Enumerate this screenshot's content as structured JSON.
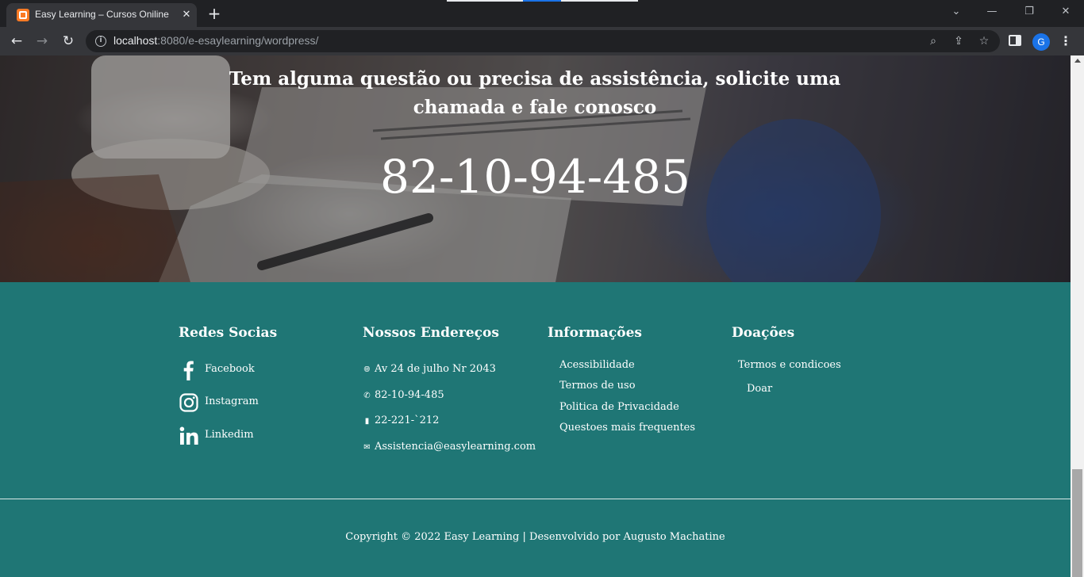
{
  "browser": {
    "tab_title": "Easy Learning – Cursos Oniline",
    "url_host": "localhost",
    "url_rest": ":8080/e-esaylearning/wordpress/",
    "profile_initial": "G"
  },
  "hero": {
    "question": "Tem alguma questão ou precisa de assistência, solicite uma chamada e fale conosco",
    "phone": "82-10-94-485"
  },
  "footer": {
    "social": {
      "title": "Redes Socias",
      "items": [
        {
          "label": "Facebook",
          "icon": "facebook-icon"
        },
        {
          "label": "Instagram",
          "icon": "instagram-icon"
        },
        {
          "label": "Linkedim",
          "icon": "linkedin-icon"
        }
      ]
    },
    "addresses": {
      "title": "Nossos Endereços",
      "items": [
        {
          "text": "Av 24 de julho Nr 2043",
          "icon": "globe-icon"
        },
        {
          "text": "82-10-94-485",
          "icon": "phone-icon"
        },
        {
          "text": "22-221-`212",
          "icon": "fax-document-icon"
        },
        {
          "text": "Assistencia@easylearning.com",
          "icon": "envelope-icon"
        }
      ]
    },
    "info": {
      "title": "Informações",
      "links": [
        "Acessibilidade",
        "Termos de uso",
        "Politica de Privacidade",
        "Questoes mais frequentes"
      ]
    },
    "donations": {
      "title": "Doações",
      "links": [
        "Termos e condicoes",
        "Doar"
      ]
    },
    "copyright": "Copyright © 2022 Easy Learning | Desenvolvido por Augusto Machatine"
  },
  "colors": {
    "footer_bg": "#1f7675",
    "browser_dark": "#202124",
    "browser_toolbar": "#35363a",
    "accent_blue": "#1a73e8"
  }
}
